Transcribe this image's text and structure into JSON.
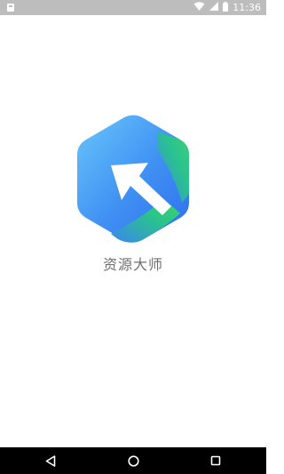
{
  "status_bar": {
    "time": "11:36",
    "icons": [
      "notification-icon",
      "wifi-icon",
      "cellular-signal-icon",
      "battery-icon"
    ]
  },
  "splash": {
    "app_name": "资源大师",
    "logo_icon": "app-logo-icon",
    "colors": {
      "blue_light": "#5ab8f8",
      "blue_dark": "#2f7bf0",
      "green": "#2ecb76",
      "text": "#707070"
    }
  },
  "nav_bar": {
    "buttons": [
      "back-icon",
      "home-icon",
      "recents-icon"
    ]
  }
}
